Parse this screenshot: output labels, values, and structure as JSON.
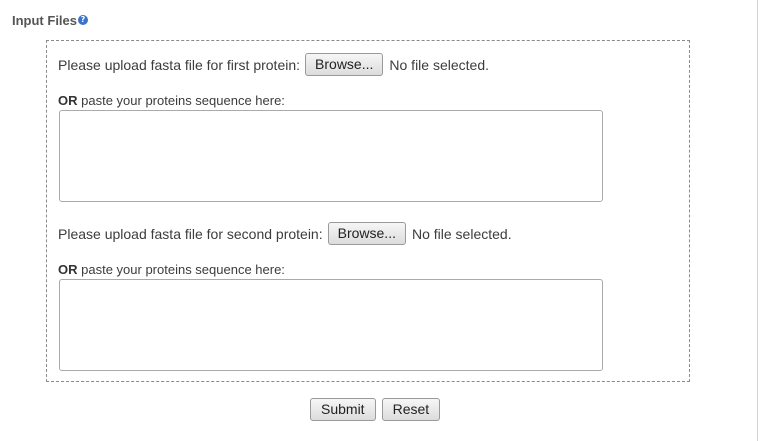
{
  "section": {
    "title": "Input Files",
    "help_icon": "question-circle-icon"
  },
  "first_protein": {
    "upload_label": "Please upload fasta file for first protein:",
    "browse_label": "Browse...",
    "file_status": "No file selected.",
    "or_word": "OR",
    "paste_label": "paste your proteins sequence here:",
    "sequence_value": ""
  },
  "second_protein": {
    "upload_label": "Please upload fasta file for second protein:",
    "browse_label": "Browse...",
    "file_status": "No file selected.",
    "or_word": "OR",
    "paste_label": "paste your proteins sequence here:",
    "sequence_value": ""
  },
  "actions": {
    "submit_label": "Submit",
    "reset_label": "Reset"
  },
  "colors": {
    "help_icon": "#3a73c8",
    "border": "#8a8a8a"
  }
}
